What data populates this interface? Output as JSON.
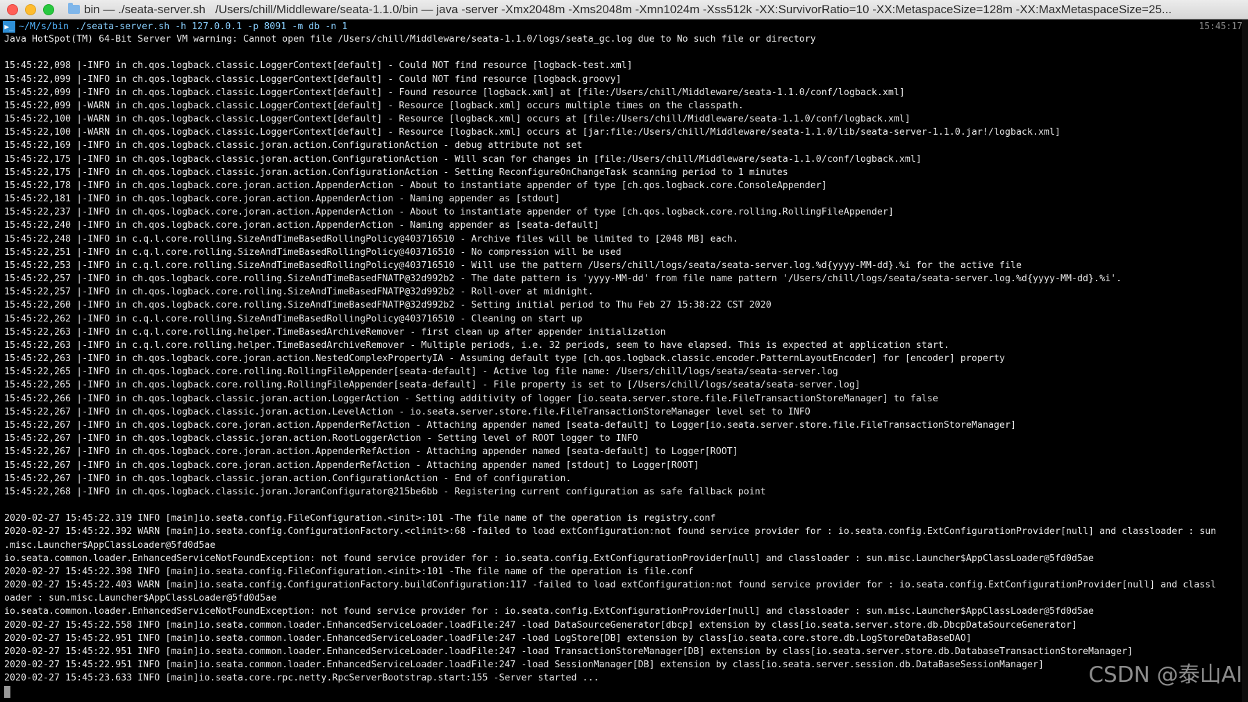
{
  "window": {
    "title": "bin — ./seata-server.sh   /Users/chill/Middleware/seata-1.1.0/bin — java -server -Xmx2048m -Xms2048m -Xmn1024m -Xss512k -XX:SurvivorRatio=10 -XX:MetaspaceSize=128m -XX:MaxMetaspaceSize=25..."
  },
  "prompt": {
    "icon": "▶_",
    "path": "~/M/s/bin",
    "command": "./seata-server.sh",
    "args": "-h 127.0.0.1 -p 8091 -m db -n 1",
    "time": "15:45:17"
  },
  "lines": [
    "Java HotSpot(TM) 64-Bit Server VM warning: Cannot open file /Users/chill/Middleware/seata-1.1.0/logs/seata_gc.log due to No such file or directory",
    "",
    "15:45:22,098 |-INFO in ch.qos.logback.classic.LoggerContext[default] - Could NOT find resource [logback-test.xml]",
    "15:45:22,099 |-INFO in ch.qos.logback.classic.LoggerContext[default] - Could NOT find resource [logback.groovy]",
    "15:45:22,099 |-INFO in ch.qos.logback.classic.LoggerContext[default] - Found resource [logback.xml] at [file:/Users/chill/Middleware/seata-1.1.0/conf/logback.xml]",
    "15:45:22,099 |-WARN in ch.qos.logback.classic.LoggerContext[default] - Resource [logback.xml] occurs multiple times on the classpath.",
    "15:45:22,100 |-WARN in ch.qos.logback.classic.LoggerContext[default] - Resource [logback.xml] occurs at [file:/Users/chill/Middleware/seata-1.1.0/conf/logback.xml]",
    "15:45:22,100 |-WARN in ch.qos.logback.classic.LoggerContext[default] - Resource [logback.xml] occurs at [jar:file:/Users/chill/Middleware/seata-1.1.0/lib/seata-server-1.1.0.jar!/logback.xml]",
    "15:45:22,169 |-INFO in ch.qos.logback.classic.joran.action.ConfigurationAction - debug attribute not set",
    "15:45:22,175 |-INFO in ch.qos.logback.classic.joran.action.ConfigurationAction - Will scan for changes in [file:/Users/chill/Middleware/seata-1.1.0/conf/logback.xml]",
    "15:45:22,175 |-INFO in ch.qos.logback.classic.joran.action.ConfigurationAction - Setting ReconfigureOnChangeTask scanning period to 1 minutes",
    "15:45:22,178 |-INFO in ch.qos.logback.core.joran.action.AppenderAction - About to instantiate appender of type [ch.qos.logback.core.ConsoleAppender]",
    "15:45:22,181 |-INFO in ch.qos.logback.core.joran.action.AppenderAction - Naming appender as [stdout]",
    "15:45:22,237 |-INFO in ch.qos.logback.core.joran.action.AppenderAction - About to instantiate appender of type [ch.qos.logback.core.rolling.RollingFileAppender]",
    "15:45:22,240 |-INFO in ch.qos.logback.core.joran.action.AppenderAction - Naming appender as [seata-default]",
    "15:45:22,248 |-INFO in c.q.l.core.rolling.SizeAndTimeBasedRollingPolicy@403716510 - Archive files will be limited to [2048 MB] each.",
    "15:45:22,251 |-INFO in c.q.l.core.rolling.SizeAndTimeBasedRollingPolicy@403716510 - No compression will be used",
    "15:45:22,253 |-INFO in c.q.l.core.rolling.SizeAndTimeBasedRollingPolicy@403716510 - Will use the pattern /Users/chill/logs/seata/seata-server.log.%d{yyyy-MM-dd}.%i for the active file",
    "15:45:22,257 |-INFO in ch.qos.logback.core.rolling.SizeAndTimeBasedFNATP@32d992b2 - The date pattern is 'yyyy-MM-dd' from file name pattern '/Users/chill/logs/seata/seata-server.log.%d{yyyy-MM-dd}.%i'.",
    "15:45:22,257 |-INFO in ch.qos.logback.core.rolling.SizeAndTimeBasedFNATP@32d992b2 - Roll-over at midnight.",
    "15:45:22,260 |-INFO in ch.qos.logback.core.rolling.SizeAndTimeBasedFNATP@32d992b2 - Setting initial period to Thu Feb 27 15:38:22 CST 2020",
    "15:45:22,262 |-INFO in c.q.l.core.rolling.SizeAndTimeBasedRollingPolicy@403716510 - Cleaning on start up",
    "15:45:22,263 |-INFO in c.q.l.core.rolling.helper.TimeBasedArchiveRemover - first clean up after appender initialization",
    "15:45:22,263 |-INFO in c.q.l.core.rolling.helper.TimeBasedArchiveRemover - Multiple periods, i.e. 32 periods, seem to have elapsed. This is expected at application start.",
    "15:45:22,263 |-INFO in ch.qos.logback.core.joran.action.NestedComplexPropertyIA - Assuming default type [ch.qos.logback.classic.encoder.PatternLayoutEncoder] for [encoder] property",
    "15:45:22,265 |-INFO in ch.qos.logback.core.rolling.RollingFileAppender[seata-default] - Active log file name: /Users/chill/logs/seata/seata-server.log",
    "15:45:22,265 |-INFO in ch.qos.logback.core.rolling.RollingFileAppender[seata-default] - File property is set to [/Users/chill/logs/seata/seata-server.log]",
    "15:45:22,266 |-INFO in ch.qos.logback.classic.joran.action.LoggerAction - Setting additivity of logger [io.seata.server.store.file.FileTransactionStoreManager] to false",
    "15:45:22,267 |-INFO in ch.qos.logback.classic.joran.action.LevelAction - io.seata.server.store.file.FileTransactionStoreManager level set to INFO",
    "15:45:22,267 |-INFO in ch.qos.logback.core.joran.action.AppenderRefAction - Attaching appender named [seata-default] to Logger[io.seata.server.store.file.FileTransactionStoreManager]",
    "15:45:22,267 |-INFO in ch.qos.logback.classic.joran.action.RootLoggerAction - Setting level of ROOT logger to INFO",
    "15:45:22,267 |-INFO in ch.qos.logback.core.joran.action.AppenderRefAction - Attaching appender named [seata-default] to Logger[ROOT]",
    "15:45:22,267 |-INFO in ch.qos.logback.core.joran.action.AppenderRefAction - Attaching appender named [stdout] to Logger[ROOT]",
    "15:45:22,267 |-INFO in ch.qos.logback.classic.joran.action.ConfigurationAction - End of configuration.",
    "15:45:22,268 |-INFO in ch.qos.logback.classic.joran.JoranConfigurator@215be6bb - Registering current configuration as safe fallback point",
    "",
    "2020-02-27 15:45:22.319 INFO [main]io.seata.config.FileConfiguration.<init>:101 -The file name of the operation is registry.conf",
    "2020-02-27 15:45:22.392 WARN [main]io.seata.config.ConfigurationFactory.<clinit>:68 -failed to load extConfiguration:not found service provider for : io.seata.config.ExtConfigurationProvider[null] and classloader : sun",
    ".misc.Launcher$AppClassLoader@5fd0d5ae",
    "io.seata.common.loader.EnhancedServiceNotFoundException: not found service provider for : io.seata.config.ExtConfigurationProvider[null] and classloader : sun.misc.Launcher$AppClassLoader@5fd0d5ae",
    "2020-02-27 15:45:22.398 INFO [main]io.seata.config.FileConfiguration.<init>:101 -The file name of the operation is file.conf",
    "2020-02-27 15:45:22.403 WARN [main]io.seata.config.ConfigurationFactory.buildConfiguration:117 -failed to load extConfiguration:not found service provider for : io.seata.config.ExtConfigurationProvider[null] and classl",
    "oader : sun.misc.Launcher$AppClassLoader@5fd0d5ae",
    "io.seata.common.loader.EnhancedServiceNotFoundException: not found service provider for : io.seata.config.ExtConfigurationProvider[null] and classloader : sun.misc.Launcher$AppClassLoader@5fd0d5ae",
    "2020-02-27 15:45:22.558 INFO [main]io.seata.common.loader.EnhancedServiceLoader.loadFile:247 -load DataSourceGenerator[dbcp] extension by class[io.seata.server.store.db.DbcpDataSourceGenerator]",
    "2020-02-27 15:45:22.951 INFO [main]io.seata.common.loader.EnhancedServiceLoader.loadFile:247 -load LogStore[DB] extension by class[io.seata.core.store.db.LogStoreDataBaseDAO]",
    "2020-02-27 15:45:22.951 INFO [main]io.seata.common.loader.EnhancedServiceLoader.loadFile:247 -load TransactionStoreManager[DB] extension by class[io.seata.server.store.db.DatabaseTransactionStoreManager]",
    "2020-02-27 15:45:22.951 INFO [main]io.seata.common.loader.EnhancedServiceLoader.loadFile:247 -load SessionManager[DB] extension by class[io.seata.server.session.db.DataBaseSessionManager]",
    "2020-02-27 15:45:23.633 INFO [main]io.seata.core.rpc.netty.RpcServerBootstrap.start:155 -Server started ..."
  ],
  "watermark": "CSDN @泰山AI",
  "colors": {
    "background": "#000000",
    "text": "#e8e8e8",
    "prompt_path": "#55b7ff",
    "prompt_command": "#8ad0ff",
    "titlebar": "#e2e2e2"
  }
}
